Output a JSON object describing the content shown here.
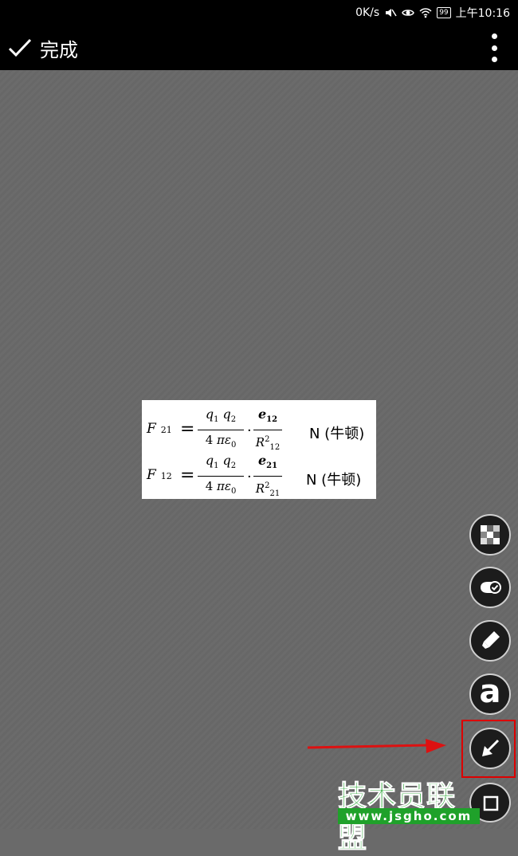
{
  "status_bar": {
    "net_speed": "0K/s",
    "battery": "99",
    "time": "上午10:16",
    "icons": [
      "mute-icon",
      "eye-icon",
      "wifi-icon",
      "battery-icon"
    ]
  },
  "toolbar": {
    "done_label": "完成",
    "done_icon": "check-icon",
    "menu_icon": "more-vert-icon"
  },
  "formula": {
    "row1": {
      "F_sub": "21",
      "num_a": "q",
      "num_a_sub": "1",
      "num_b": "q",
      "num_b_sub": "2",
      "den_a": "4",
      "den_b": "πε",
      "den_b_sub": "0",
      "e": "e",
      "e_sub": "12",
      "R": "R",
      "R_sub": "12",
      "R_sup": "2",
      "unit": "N (牛顿)"
    },
    "row2": {
      "F_sub": "12",
      "num_a": "q",
      "num_a_sub": "1",
      "num_b": "q",
      "num_b_sub": "2",
      "den_a": "4",
      "den_b": "πε",
      "den_b_sub": "0",
      "e": "e",
      "e_sub": "21",
      "R": "R",
      "R_sub": "21",
      "R_sup": "2",
      "unit": "N (牛顿)"
    },
    "F": "F",
    "eq": "=",
    "dot": "·"
  },
  "tools": [
    {
      "name": "mosaic-tool",
      "icon": "mosaic-icon"
    },
    {
      "name": "eraser-tool",
      "icon": "eraser-icon"
    },
    {
      "name": "highlighter-tool",
      "icon": "marker-icon"
    },
    {
      "name": "text-tool",
      "icon": "letter-a-icon",
      "label": "a"
    },
    {
      "name": "arrow-tool",
      "icon": "arrow-down-left-icon"
    },
    {
      "name": "crop-tool",
      "icon": "crop-icon"
    }
  ],
  "watermark": {
    "title": "技术员联盟",
    "url": "www.jsgho.com"
  },
  "colors": {
    "accent_red": "#dd0000",
    "watermark_green": "#1fa12a"
  }
}
